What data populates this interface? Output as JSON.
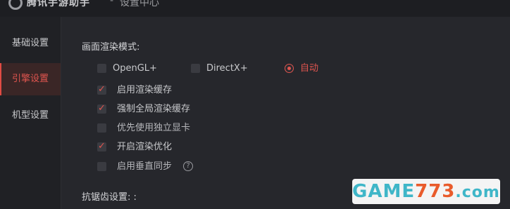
{
  "titlebar": {
    "app_name": "腾讯手游助手",
    "separator": "-",
    "section": "设置中心"
  },
  "sidebar": {
    "items": [
      {
        "label": "基础设置",
        "active": false
      },
      {
        "label": "引擎设置",
        "active": true
      },
      {
        "label": "机型设置",
        "active": false
      }
    ]
  },
  "render_mode": {
    "title": "画面渲染模式:",
    "options": [
      {
        "label": "OpenGL+",
        "selected": false
      },
      {
        "label": "DirectX+",
        "selected": false
      },
      {
        "label": "自动",
        "selected": true
      }
    ]
  },
  "checkboxes": [
    {
      "label": "启用渲染缓存",
      "checked": true
    },
    {
      "label": "强制全局渲染缓存",
      "checked": true
    },
    {
      "label": "优先使用独立显卡",
      "checked": false
    },
    {
      "label": "开启渲染优化",
      "checked": true
    },
    {
      "label": "启用垂直同步",
      "checked": false,
      "help": "?"
    }
  ],
  "antialias": {
    "title": "抗锯齿设置: :"
  },
  "watermark": {
    "part1": "GAME",
    "part2": "773",
    "part3": ".com"
  },
  "colors": {
    "accent": "#e0554f",
    "background": "#26272c",
    "sidebar": "#202125"
  }
}
